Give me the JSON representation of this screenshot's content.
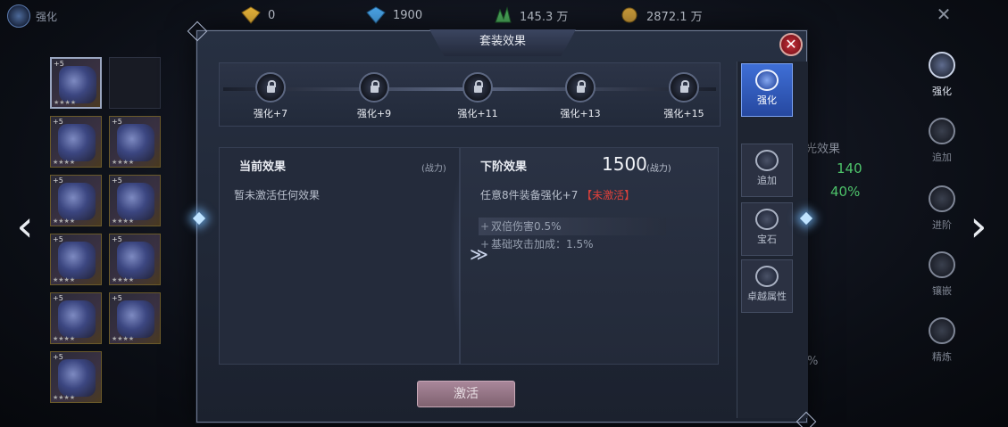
{
  "topbar": {
    "title": "强化",
    "resources": [
      {
        "icon": "gold-diamond-icon",
        "value": "0"
      },
      {
        "icon": "blue-diamond-icon",
        "value": "1900"
      },
      {
        "icon": "green-crystal-icon",
        "value": "145.3 万"
      },
      {
        "icon": "gold-coin-icon",
        "value": "2872.1 万"
      }
    ],
    "close_glyph": "✕"
  },
  "nav": {
    "prev_glyph": "‹",
    "next_glyph": "›"
  },
  "inventory": {
    "slots": [
      {
        "level": "+5",
        "stars": "★★★★"
      },
      {
        "level": "",
        "stars": ""
      },
      {
        "level": "+5",
        "stars": "★★★★"
      },
      {
        "level": "+5",
        "stars": "★★★★"
      },
      {
        "level": "+5",
        "stars": "★★★★"
      },
      {
        "level": "+5",
        "stars": "★★★★"
      },
      {
        "level": "+5",
        "stars": "★★★★"
      },
      {
        "level": "+5",
        "stars": "★★★★"
      },
      {
        "level": "+5",
        "stars": "★★★★"
      },
      {
        "level": "+5",
        "stars": "★★★★"
      },
      {
        "level": "+5",
        "stars": "★★★★"
      }
    ]
  },
  "background_panel": {
    "effect_label": "光效果",
    "value_1": "140",
    "value_2": "40%",
    "percent_fragment": "%"
  },
  "right_nav": {
    "items": [
      {
        "label": "强化",
        "icon": "anvil-icon",
        "active": true
      },
      {
        "label": "追加",
        "icon": "sword-shield-icon",
        "active": false
      },
      {
        "label": "进阶",
        "icon": "upgrade-icon",
        "active": false
      },
      {
        "label": "镶嵌",
        "icon": "gem-socket-icon",
        "active": false
      },
      {
        "label": "精炼",
        "icon": "refine-icon",
        "active": false
      }
    ]
  },
  "dialog": {
    "title": "套装效果",
    "close_glyph": "✕",
    "milestones": [
      "强化+7",
      "强化+9",
      "强化+11",
      "强化+13",
      "强化+15"
    ],
    "current": {
      "heading": "当前效果",
      "power_label": "(战力)",
      "text": "暂未激活任何效果"
    },
    "next": {
      "heading": "下阶效果",
      "power_value": "1500",
      "power_label": "(战力)",
      "condition": "任意8件装备强化+7",
      "status_open": "【",
      "status": "未激活",
      "status_close": "】",
      "buffs": [
        "双倍伤害0.5%",
        "基础攻击加成：1.5%"
      ]
    },
    "activate_label": "激活",
    "chevron_glyph": "≫",
    "tabs": [
      {
        "label": "强化",
        "icon": "anvil-icon",
        "active": true
      },
      {
        "label": "追加",
        "icon": "add-icon",
        "active": false
      },
      {
        "label": "宝石",
        "icon": "gem-icon",
        "active": false
      },
      {
        "label": "卓越属性",
        "icon": "excellence-icon",
        "active": false
      }
    ]
  }
}
